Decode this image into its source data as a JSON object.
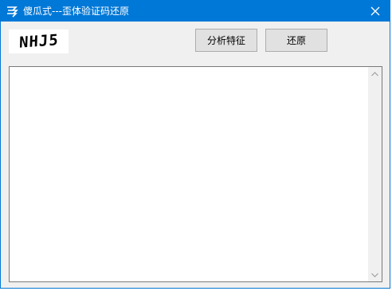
{
  "window": {
    "title": "傻瓜式---歪体验证码还原",
    "accent_color": "#0078d7",
    "icon": "app-logo-icon",
    "close_icon": "close-icon"
  },
  "captcha": {
    "text": "NHJ5"
  },
  "toolbar": {
    "analyze_label": "分析特征",
    "restore_label": "还原"
  },
  "output": {
    "value": "",
    "scroll_up_icon": "scroll-up-arrow-icon",
    "scroll_down_icon": "scroll-down-arrow-icon"
  }
}
